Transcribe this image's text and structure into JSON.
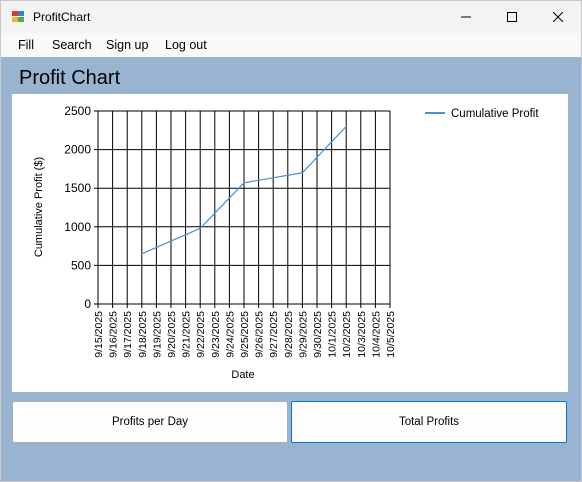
{
  "window": {
    "title": "ProfitChart"
  },
  "menu": {
    "items": [
      "Fill",
      "Search",
      "Sign up",
      "Log out"
    ]
  },
  "page": {
    "title": "Profit Chart"
  },
  "buttons": {
    "profits_per_day": "Profits per Day",
    "total_profits": "Total Profits"
  },
  "chart_data": {
    "type": "line",
    "xlabel": "Date",
    "ylabel": "Cumulative Profit ($)",
    "ylim": [
      0,
      2500
    ],
    "yticks": [
      0,
      500,
      1000,
      1500,
      2000,
      2500
    ],
    "x_tick_labels": [
      "9/15/2025",
      "9/16/2025",
      "9/17/2025",
      "9/18/2025",
      "9/19/2025",
      "9/20/2025",
      "9/21/2025",
      "9/22/2025",
      "9/23/2025",
      "9/24/2025",
      "9/25/2025",
      "9/26/2025",
      "9/27/2025",
      "9/28/2025",
      "9/29/2025",
      "9/30/2025",
      "10/1/2025",
      "10/2/2025",
      "10/3/2025",
      "10/4/2025",
      "10/5/2025"
    ],
    "grid": true,
    "legend": "top-right",
    "series": [
      {
        "name": "Cumulative Profit",
        "color": "#4a90d9",
        "points": [
          {
            "x": "9/18/2025",
            "y": 650
          },
          {
            "x": "9/22/2025",
            "y": 980
          },
          {
            "x": "9/25/2025",
            "y": 1570
          },
          {
            "x": "9/29/2025",
            "y": 1700
          },
          {
            "x": "10/2/2025",
            "y": 2300
          }
        ]
      }
    ]
  }
}
